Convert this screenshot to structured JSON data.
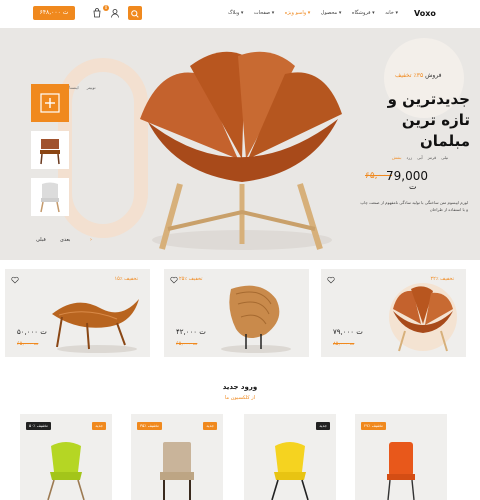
{
  "header": {
    "logo": "Voxo",
    "cart_amount": "۶۴۸,۰۰۰ ت",
    "cart_badge": "0",
    "nav": [
      {
        "label": "خانه ▾",
        "active": false
      },
      {
        "label": "فروشگاه ▾",
        "active": false
      },
      {
        "label": "محصول ▾",
        "active": false
      },
      {
        "label": "واسو ویژه ▾",
        "active": true
      },
      {
        "label": "صفحات ▾",
        "active": false
      },
      {
        "label": "وبلاگ ▾",
        "active": false
      }
    ]
  },
  "hero": {
    "social": [
      "فیسبوک",
      "اینستاگرام",
      "توییتر"
    ],
    "nav_next": "بعدی",
    "nav_prev": "قبلی",
    "discount_prefix": "فروش",
    "discount_value": "۳۵٪ تخفیف",
    "title_line1": "جدیدترین و",
    "title_line2": "تازه ترین",
    "title_line3": "مبلمان",
    "colors": [
      "بنفش",
      "زرد",
      "آبی",
      "قرمز",
      "نیلی"
    ],
    "selected_color": "بنفش",
    "old_price": "۶۵,۰۰۰",
    "new_price": "79,000",
    "currency": "ت",
    "description": "لورم ایپسوم متن ساختگی با تولید سادگی نامفهوم از صنعت چاپ و با استفاده از طراحان"
  },
  "promos": [
    {
      "discount": "۱۵٪ تخفیف",
      "price": "۵۰,۰۰۰ ت",
      "old": "۶۵,۰۰۰ ت"
    },
    {
      "discount": "۲۵٪ تخفیف",
      "price": "۴۲,۰۰۰ ت",
      "old": "۶۵,۰۰۰ ت"
    },
    {
      "discount": "۲۲٪ تخفیف",
      "price": "۷۹,۰۰۰ ت",
      "old": "۸۵,۰۰۰ ت"
    }
  ],
  "new_arrivals": {
    "title": "ورود جدید",
    "subtitle": "از کلکسیون ما",
    "products": [
      {
        "badge_dark": "۵۰٪ تخفیف",
        "badge_orange": "جدید"
      },
      {
        "badge_dark": "۳۵٪ تخفیف",
        "badge_orange": "جدید"
      },
      {
        "badge_dark": "جدید",
        "badge_orange": ""
      },
      {
        "badge_dark": "",
        "badge_orange": "۲۷٪ تخفیف"
      }
    ]
  },
  "colors": {
    "accent": "#f0891e",
    "hero_bg": "#e9e7e4",
    "card_bg": "#efeeec"
  }
}
